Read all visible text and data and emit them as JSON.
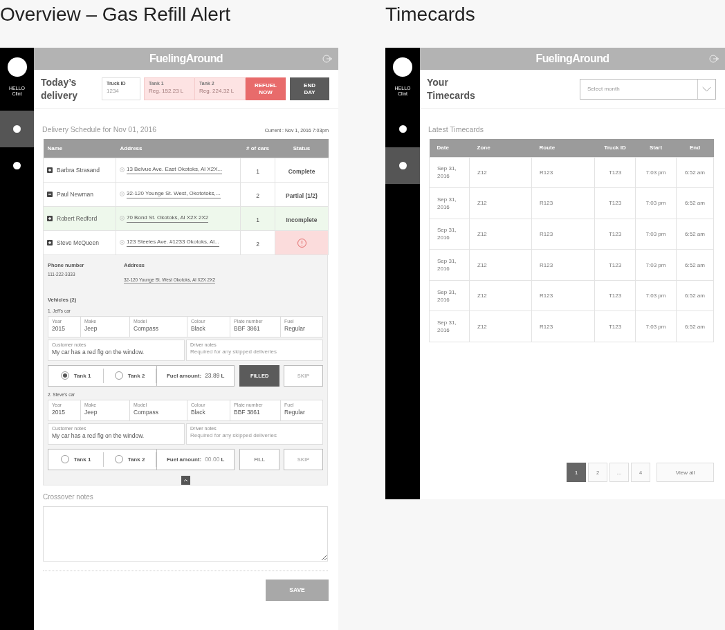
{
  "overview": {
    "heading": "Overview – Gas Refill Alert",
    "sidebar": {
      "greeting": "HELLO",
      "user": "Clint",
      "nav": [
        {
          "selected": true
        },
        {
          "selected": false
        }
      ]
    },
    "app_bar": {
      "logo": "FuelingAround"
    },
    "title": "Today’s delivery",
    "truck_id": {
      "label": "Truck ID",
      "placeholder": "1234"
    },
    "tanks": [
      {
        "label": "Tank 1",
        "value": "Reg. 152.23 L"
      },
      {
        "label": "Tank 2",
        "value": "Reg. 224.32 L"
      }
    ],
    "refuel_button": "REFUEL NOW",
    "end_day_button": "END DAY",
    "schedule": {
      "title": "Delivery Schedule for Nov 01, 2016",
      "current": "Current : Nov 1, 2016 7:03pm"
    },
    "table": {
      "columns": [
        "Name",
        "Address",
        "# of cars",
        "Status"
      ],
      "rows": [
        {
          "name": "Barbra Strasand",
          "expanded": false,
          "address": "13 Belvue Ave. East Okotoks, Al X2X...",
          "cars": "1",
          "highlighted": false,
          "status": {
            "kind": "text",
            "text": "Complete"
          }
        },
        {
          "name": "Paul Newman",
          "expanded": true,
          "address": "32-120 Younge St. West, Okototoks,...",
          "cars": "2",
          "highlighted": false,
          "status": {
            "kind": "text",
            "text": "Partial (1/2)"
          }
        },
        {
          "name": "Robert Redford",
          "expanded": false,
          "address": "70 Bond St. Okotoks, Al X2X 2X2",
          "cars": "1",
          "highlighted": true,
          "status": {
            "kind": "text",
            "text": "Incomplete"
          }
        },
        {
          "name": "Steve McQueen",
          "expanded": false,
          "address": "123 Steeles Ave. #1233 Okotoks, Al...",
          "cars": "2",
          "highlighted": false,
          "status": {
            "kind": "alert"
          }
        }
      ]
    },
    "detail": {
      "phone_label": "Phone number",
      "phone": "111-222-3333",
      "address_label": "Address",
      "address": "32-120 Younge St. West Okotoks, Al X2X 2X2",
      "vehicles_title": "Vehicles (2)",
      "vehicles": [
        {
          "title": "1. Jeff's car",
          "fields": [
            {
              "label": "Year",
              "value": "2015"
            },
            {
              "label": "Make",
              "value": "Jeep"
            },
            {
              "label": "Model",
              "value": "Compass"
            },
            {
              "label": "Colour",
              "value": "Black"
            },
            {
              "label": "Plate number",
              "value": "BBF 3861"
            },
            {
              "label": "Fuel",
              "value": "Regular"
            }
          ],
          "customer_notes": {
            "label": "Customer notes",
            "value": "My car has a red flg on the window."
          },
          "driver_notes": {
            "label": "Driver notes",
            "placeholder": "Required for any skipped deliveries"
          },
          "tanks": [
            {
              "label": "Tank 1",
              "selected": true
            },
            {
              "label": "Tank 2",
              "selected": false
            }
          ],
          "fuel_label": "Fuel amount:",
          "fuel_value": "23.89",
          "fuel_unit": "L",
          "fill_button": {
            "label": "FILLED",
            "filled": true
          },
          "skip_button": "SKIP"
        },
        {
          "title": "2. Steve's car",
          "fields": [
            {
              "label": "Year",
              "value": "2015"
            },
            {
              "label": "Make",
              "value": "Jeep"
            },
            {
              "label": "Model",
              "value": "Compass"
            },
            {
              "label": "Colour",
              "value": "Black"
            },
            {
              "label": "Plate number",
              "value": "BBF 3861"
            },
            {
              "label": "Fuel",
              "value": "Regular"
            }
          ],
          "customer_notes": {
            "label": "Customer notes",
            "value": "My car has a red flg on the window."
          },
          "driver_notes": {
            "label": "Driver notes",
            "placeholder": "Required for any skipped deliveries"
          },
          "tanks": [
            {
              "label": "Tank 1",
              "selected": false
            },
            {
              "label": "Tank 2",
              "selected": false
            }
          ],
          "fuel_label": "Fuel amount:",
          "fuel_placeholder": "00.00",
          "fuel_unit": "L",
          "fill_button": {
            "label": "FILL",
            "filled": false
          },
          "skip_button": "SKIP"
        }
      ]
    },
    "crossover": {
      "label": "Crossover notes"
    },
    "save_button": {
      "label": "SAVE",
      "disabled": true
    }
  },
  "timecards": {
    "heading": "Timecards",
    "sidebar": {
      "greeting": "HELLO",
      "user": "Clint",
      "nav": [
        {
          "selected": false
        },
        {
          "selected": true
        }
      ]
    },
    "app_bar": {
      "logo": "FuelingAround"
    },
    "title": "Your Timecards",
    "month_select": {
      "placeholder": "Select month"
    },
    "section_title": "Latest Timecards",
    "table": {
      "columns": [
        "Date",
        "Zone",
        "Route",
        "Truck ID",
        "Start",
        "End"
      ],
      "rows": [
        [
          "Sep 31, 2016",
          "Z12",
          "R123",
          "T123",
          "7:03 pm",
          "6:52 am"
        ],
        [
          "Sep 31, 2016",
          "Z12",
          "R123",
          "T123",
          "7:03 pm",
          "6:52 am"
        ],
        [
          "Sep 31, 2016",
          "Z12",
          "R123",
          "T123",
          "7:03 pm",
          "6:52 am"
        ],
        [
          "Sep 31, 2016",
          "Z12",
          "R123",
          "T123",
          "7:03 pm",
          "6:52 am"
        ],
        [
          "Sep 31, 2016",
          "Z12",
          "R123",
          "T123",
          "7:03 pm",
          "6:52 am"
        ],
        [
          "Sep 31, 2016",
          "Z12",
          "R123",
          "T123",
          "7:03 pm",
          "6:52 am"
        ]
      ]
    },
    "pagination": {
      "pages": [
        {
          "label": "1",
          "selected": true
        },
        {
          "label": "2",
          "selected": false
        },
        {
          "label": "...",
          "selected": false
        },
        {
          "label": "4",
          "selected": false
        }
      ],
      "view_all": "View all"
    }
  }
}
